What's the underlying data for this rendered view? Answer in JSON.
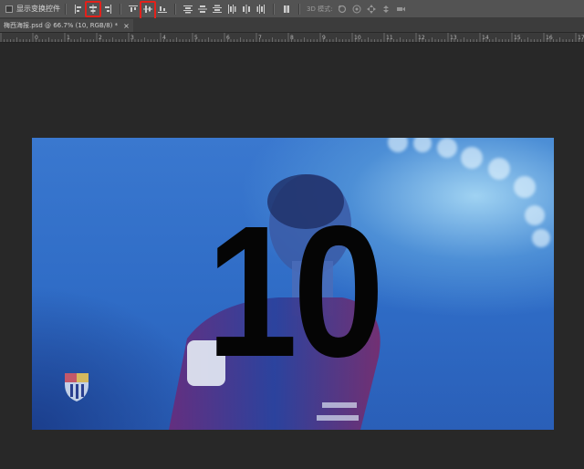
{
  "options_bar": {
    "show_transform_controls_label": "显示变换控件",
    "mode_3d_label": "3D 模式:",
    "align_icons": [
      "align-left-edges-icon",
      "align-horizontal-centers-icon",
      "align-right-edges-icon",
      "align-top-edges-icon",
      "align-vertical-centers-icon",
      "align-bottom-edges-icon"
    ],
    "distribute_icons": [
      "distribute-top-icon",
      "distribute-vcenter-icon",
      "distribute-bottom-icon",
      "distribute-left-icon",
      "distribute-hcenter-icon",
      "distribute-right-icon"
    ],
    "highlight_color": "#e3211b"
  },
  "document": {
    "tab_title": "梅西海报.psd @ 66.7% (10, RGB/8) *",
    "close_glyph": "×"
  },
  "ruler": {
    "labels": [
      "0",
      "1",
      "2",
      "3",
      "4",
      "5",
      "6",
      "7",
      "8",
      "9",
      "10",
      "11",
      "12",
      "13",
      "14",
      "15",
      "16",
      "17"
    ]
  },
  "canvas": {
    "big_number": "10",
    "background_color": "#2f6cc6",
    "text_color": "#050505"
  }
}
